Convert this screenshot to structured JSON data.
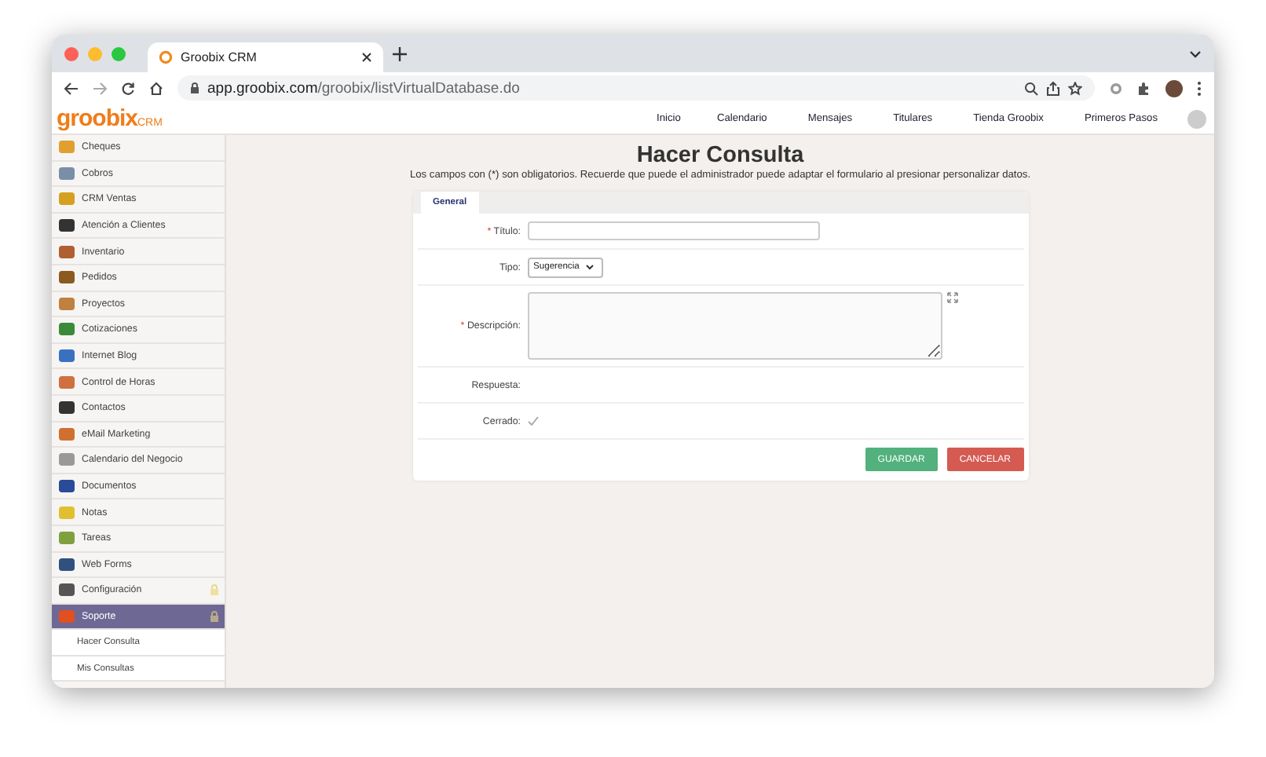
{
  "browser": {
    "tab_title": "Groobix CRM",
    "url_domain": "app.groobix.com",
    "url_path": "/groobix/listVirtualDatabase.do"
  },
  "header": {
    "logo": "groobix",
    "logo_suffix": "CRM",
    "nav": [
      "Inicio",
      "Calendario",
      "Mensajes",
      "Titulares",
      "Tienda Groobix",
      "Primeros Pasos"
    ]
  },
  "sidebar": {
    "items": [
      {
        "label": "Cheques",
        "kind": "app",
        "selected": false,
        "locked": false
      },
      {
        "label": "Cobros",
        "kind": "app",
        "selected": false,
        "locked": false
      },
      {
        "label": "CRM Ventas",
        "kind": "app",
        "selected": false,
        "locked": false
      },
      {
        "label": "Atención a Clientes",
        "kind": "app",
        "selected": false,
        "locked": false
      },
      {
        "label": "Inventario",
        "kind": "app",
        "selected": false,
        "locked": false
      },
      {
        "label": "Pedidos",
        "kind": "app",
        "selected": false,
        "locked": false
      },
      {
        "label": "Proyectos",
        "kind": "app",
        "selected": false,
        "locked": false
      },
      {
        "label": "Cotizaciones",
        "kind": "app",
        "selected": false,
        "locked": false
      },
      {
        "label": "Internet Blog",
        "kind": "app",
        "selected": false,
        "locked": false
      },
      {
        "label": "Control de Horas",
        "kind": "app",
        "selected": false,
        "locked": false
      },
      {
        "label": "Contactos",
        "kind": "app",
        "selected": false,
        "locked": false
      },
      {
        "label": "eMail Marketing",
        "kind": "app",
        "selected": false,
        "locked": false
      },
      {
        "label": "Calendario del Negocio",
        "kind": "app",
        "selected": false,
        "locked": false
      },
      {
        "label": "Documentos",
        "kind": "app",
        "selected": false,
        "locked": false
      },
      {
        "label": "Notas",
        "kind": "app",
        "selected": false,
        "locked": false
      },
      {
        "label": "Tareas",
        "kind": "app",
        "selected": false,
        "locked": false
      },
      {
        "label": "Web Forms",
        "kind": "app",
        "selected": false,
        "locked": false
      },
      {
        "label": "Configuración",
        "kind": "app",
        "selected": false,
        "locked": true
      },
      {
        "label": "Soporte",
        "kind": "app",
        "selected": true,
        "locked": true
      },
      {
        "label": "Hacer Consulta",
        "kind": "sub",
        "selected": false,
        "locked": false
      },
      {
        "label": "Mis Consultas",
        "kind": "sub",
        "selected": false,
        "locked": false
      }
    ]
  },
  "page": {
    "title": "Hacer Consulta",
    "notice": "Los campos con (*) son obligatorios. Recuerde que puede el administrador puede adaptar el formulario al presionar personalizar datos."
  },
  "form": {
    "tabs": [
      {
        "label": "General",
        "selected": true
      }
    ],
    "fields": [
      {
        "required_mark": "*",
        "label": "Título:",
        "kind": "text"
      },
      {
        "label": "Tipo:",
        "kind": "select",
        "value": "Sugerencia"
      },
      {
        "required_mark": "*",
        "label": "Descripción:",
        "kind": "textarea"
      },
      {
        "label": "Respuesta:",
        "kind": "empty"
      },
      {
        "label": "Cerrado:",
        "kind": "check",
        "checked": true
      }
    ],
    "buttons": [
      {
        "label": "GUARDAR",
        "kind": "primary"
      },
      {
        "label": "CANCELAR",
        "kind": "danger"
      }
    ]
  }
}
